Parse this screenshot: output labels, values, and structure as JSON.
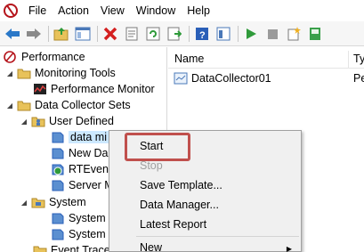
{
  "menubar": {
    "items": [
      "File",
      "Action",
      "View",
      "Window",
      "Help"
    ]
  },
  "toolbar": {
    "icons": [
      "back-arrow-icon",
      "forward-arrow-icon",
      "up-folder-icon",
      "show-hide-tree-icon",
      "delete-icon",
      "properties-icon",
      "refresh-icon",
      "export-icon",
      "help-icon",
      "console-icon",
      "start-icon",
      "stop-icon",
      "new-icon",
      "save-icon"
    ]
  },
  "tree": {
    "root": "Performance",
    "monitoring_tools": "Monitoring Tools",
    "performance_monitor": "Performance Monitor",
    "data_collector_sets": "Data Collector Sets",
    "user_defined": "User Defined",
    "data_mi": "data mi",
    "new_da": "New Da",
    "rtevent": "RTEvent",
    "server_m": "Server M",
    "system": "System",
    "system_1": "System",
    "system_2": "System",
    "event_trace": "Event Trace"
  },
  "list": {
    "headers": [
      "Name",
      "Ty"
    ],
    "rows": [
      {
        "name": "DataCollector01",
        "type": "Pe"
      }
    ]
  },
  "context_menu": {
    "start": "Start",
    "stop": "Stop",
    "save_template": "Save Template...",
    "data_manager": "Data Manager...",
    "latest_report": "Latest Report",
    "new": "New"
  },
  "colors": {
    "accent_red": "#c0504d",
    "selection": "#cce8ff",
    "menu_bg": "#f0f0f0"
  }
}
